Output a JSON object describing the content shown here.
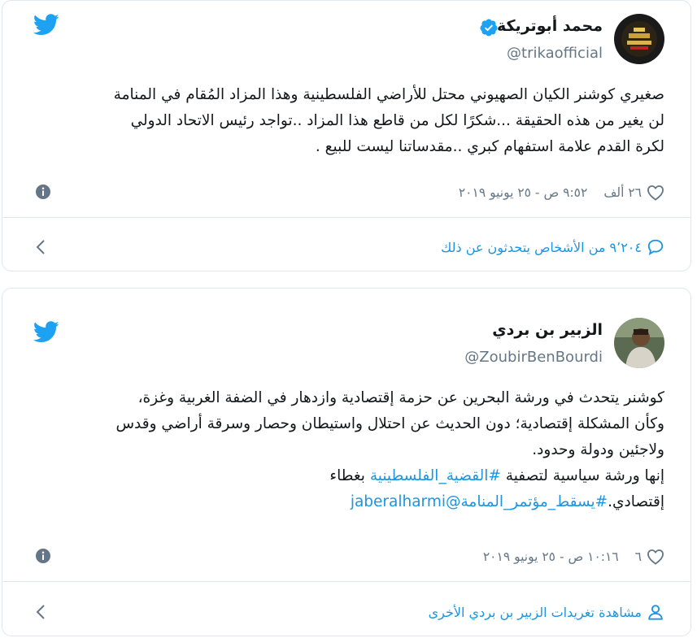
{
  "tweets": [
    {
      "author_name": "محمد أبوتريكة",
      "handle": "@trikaofficial",
      "verified": true,
      "text_lines": [
        "صغيري كوشنر الكيان الصهيوني محتل للأراضي الفلسطينية وهذا المزاد المُقام في المنامة",
        "لن يغير من هذه الحقيقة ...شكرًا لكل من قاطع هذا المزاد ..تواجد رئيس الاتحاد الدولي",
        "لكرة القدم علامة استفهام كبري ..مقدساتنا ليست للبيع ."
      ],
      "likes": "٢٦ ألف",
      "timestamp": "٩:٥٢ ص - ٢٥ يونيو ٢٠١٩",
      "footer": {
        "icon": "comment-icon",
        "text": "٩٬٢٠٤ من الأشخاص يتحدثون عن ذلك"
      }
    },
    {
      "author_name": "الزبير بن بردي",
      "handle": "@ZoubirBenBourdi",
      "verified": false,
      "text_lines": [
        "كوشنر يتحدث في ورشة البحرين عن حزمة إقتصادية وازدهار في الضفة الغربية وغزة،",
        "وكأن المشكلة إقتصادية؛ دون الحديث عن احتلال واستيطان وحصار وسرقة أراضي وقدس",
        "ولاجئين ودولة وحدود."
      ],
      "text_line4_prefix": "إنها ورشة سياسية لتصفية ",
      "text_line4_hashtag": "#القضية_الفلسطينية",
      "text_line4_suffix": " بغطاء",
      "text_line5_prefix": "إقتصادي.",
      "text_line5_hashtag": "#يسقط_مؤتمر_المنامة",
      "text_line5_mention": "@jaberalharmi",
      "likes": "٦",
      "timestamp": "١٠:١٦ ص - ٢٥ يونيو ٢٠١٩",
      "footer": {
        "icon": "person-icon",
        "text": "مشاهدة تغريدات الزبير بن بردي الأخرى"
      }
    }
  ],
  "colors": {
    "twitter_blue": "#1da1f2",
    "link": "#1b95e0",
    "secondary_text": "#657786",
    "border": "#e1e8ed"
  }
}
